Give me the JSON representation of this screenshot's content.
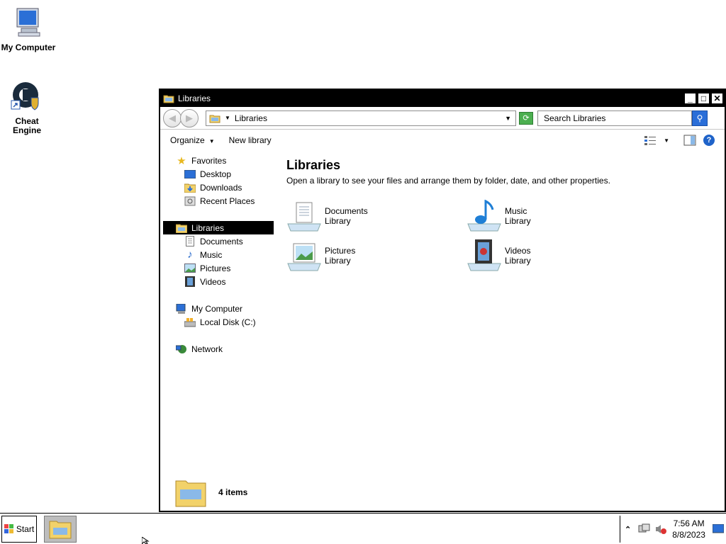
{
  "desktop": {
    "icons": [
      {
        "label": "My Computer"
      },
      {
        "label": "Cheat Engine"
      }
    ]
  },
  "window": {
    "title": "Libraries",
    "buttons": {
      "minimize": "_",
      "maximize": "□",
      "close": "✕"
    },
    "address": {
      "text": "Libraries",
      "search_placeholder": "Search Libraries"
    },
    "toolbar": {
      "organize": "Organize",
      "new_library": "New library"
    },
    "nav": {
      "favorites": "Favorites",
      "desktop": "Desktop",
      "downloads": "Downloads",
      "recent_places": "Recent Places",
      "libraries": "Libraries",
      "documents": "Documents",
      "music": "Music",
      "pictures": "Pictures",
      "videos": "Videos",
      "my_computer": "My Computer",
      "local_disk": "Local Disk (C:)",
      "network": "Network"
    },
    "main": {
      "heading": "Libraries",
      "subtitle": "Open a library to see your files and arrange them by folder, date, and other properties.",
      "libraries": [
        {
          "name": "Documents",
          "type": "Library"
        },
        {
          "name": "Music",
          "type": "Library"
        },
        {
          "name": "Pictures",
          "type": "Library"
        },
        {
          "name": "Videos",
          "type": "Library"
        }
      ]
    },
    "status": {
      "count": "4 items"
    }
  },
  "taskbar": {
    "start": "Start",
    "time": "7:56 AM",
    "date": "8/8/2023"
  }
}
